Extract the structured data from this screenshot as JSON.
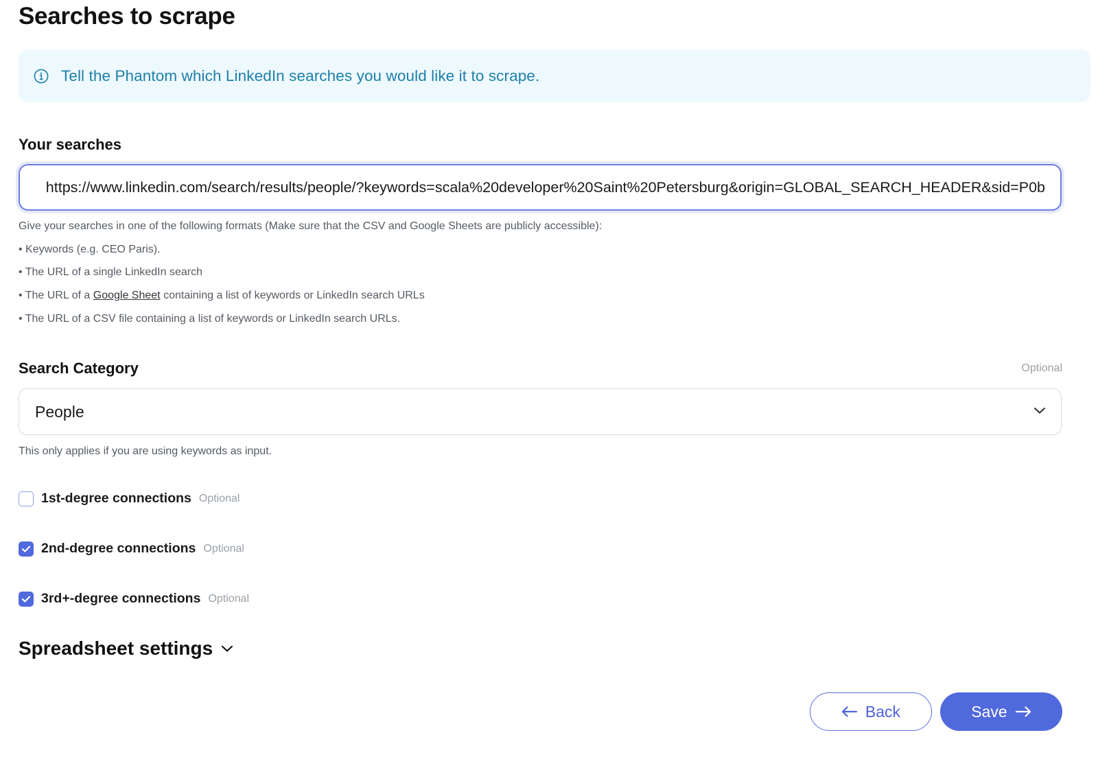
{
  "page": {
    "title": "Searches to scrape"
  },
  "info_banner": {
    "icon": "info-icon",
    "text": "Tell the Phantom which LinkedIn searches you would like it to scrape."
  },
  "searches": {
    "label": "Your searches",
    "value": "https://www.linkedin.com/search/results/people/?keywords=scala%20developer%20Saint%20Petersburg&origin=GLOBAL_SEARCH_HEADER&sid=P0b",
    "help_intro": "Give your searches in one of the following formats (Make sure that the CSV and Google Sheets are publicly accessible):",
    "help_item_1": "• Keywords (e.g. CEO Paris).",
    "help_item_2": "• The URL of a single LinkedIn search",
    "help_item_3_prefix": "• The URL of a ",
    "help_item_3_link": "Google Sheet",
    "help_item_3_suffix": " containing a list of keywords or LinkedIn search URLs",
    "help_item_4": "• The URL of a CSV file containing a list of keywords or LinkedIn search URLs."
  },
  "search_category": {
    "label": "Search Category",
    "optional_label": "Optional",
    "selected": "People",
    "help": "This only applies if you are using keywords as input."
  },
  "connections": [
    {
      "label": "1st-degree connections",
      "optional_label": "Optional",
      "checked": false
    },
    {
      "label": "2nd-degree connections",
      "optional_label": "Optional",
      "checked": true
    },
    {
      "label": "3rd+-degree connections",
      "optional_label": "Optional",
      "checked": true
    }
  ],
  "spreadsheet_settings": {
    "title": "Spreadsheet settings"
  },
  "footer": {
    "back_label": "Back",
    "save_label": "Save"
  },
  "colors": {
    "accent": "#5069dc",
    "info_bg": "#eef9fe",
    "info_text": "#1d7fa8"
  }
}
